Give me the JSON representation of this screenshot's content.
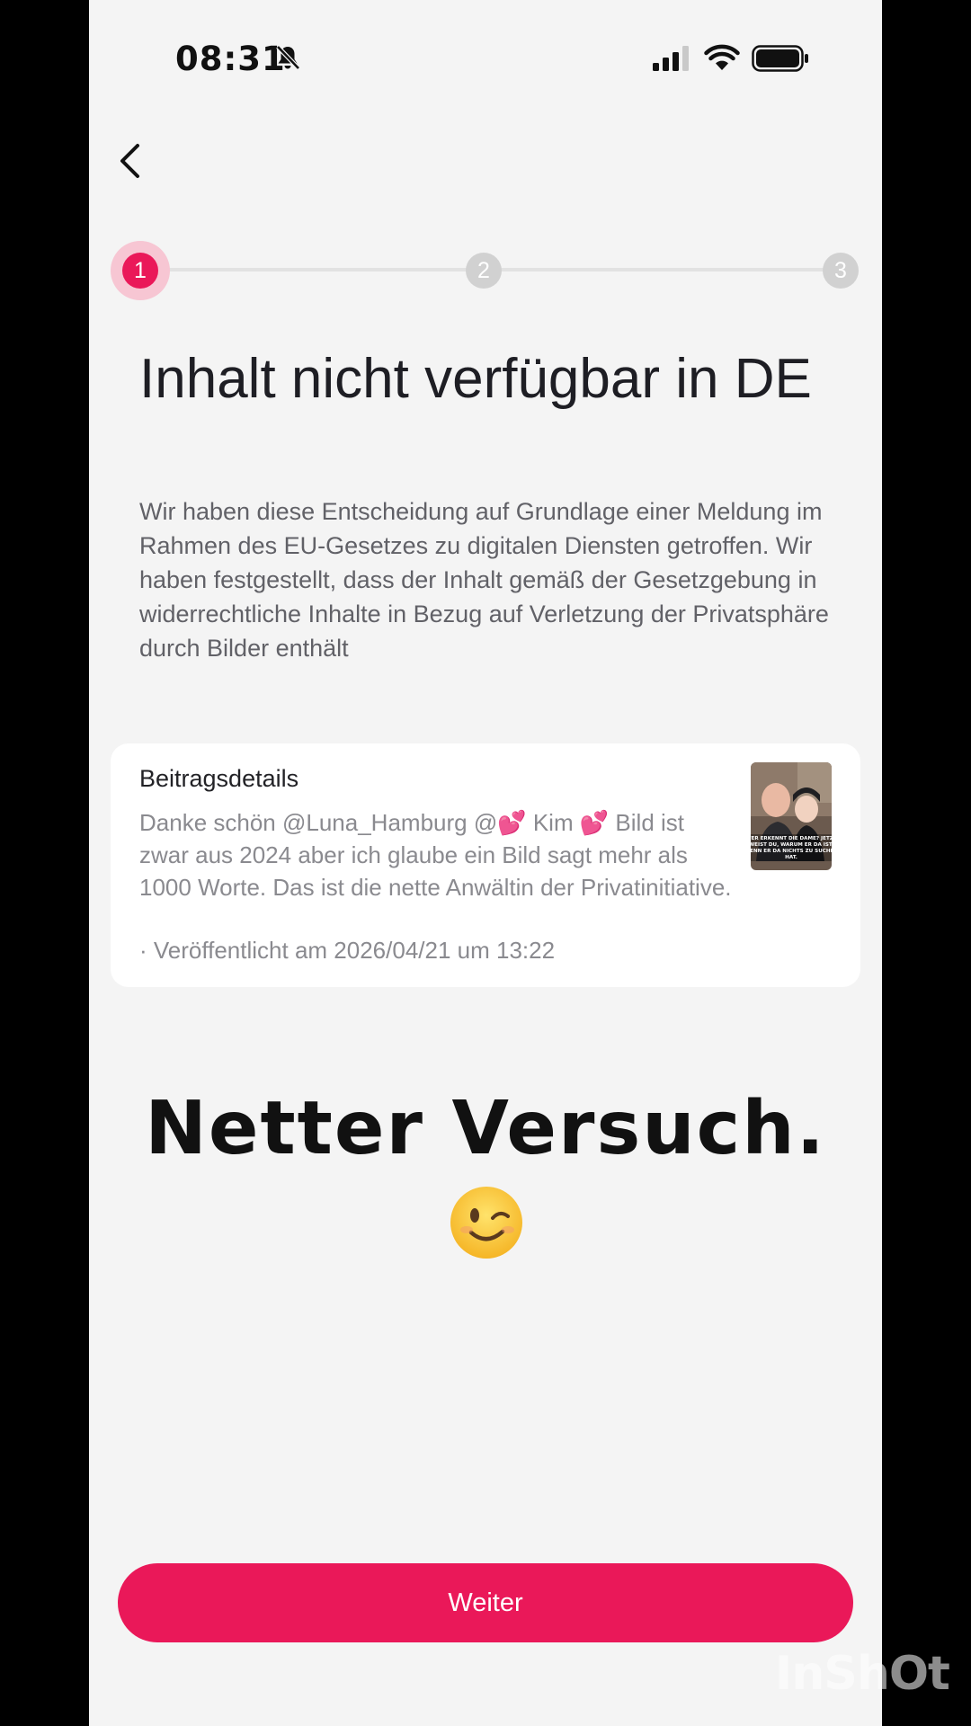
{
  "status_bar": {
    "time": "08:31",
    "icons": [
      "bell-muted-icon",
      "cellular-signal-icon",
      "wifi-icon",
      "battery-icon"
    ]
  },
  "navigation": {
    "back_icon": "chevron-left-icon"
  },
  "stepper": {
    "steps": [
      "1",
      "2",
      "3"
    ],
    "current_step": 1,
    "active_color": "#ea1859",
    "inactive_color": "#d1d1d1"
  },
  "main": {
    "title": "Inhalt nicht verfügbar in DE",
    "description": "Wir haben diese Entscheidung auf Grundlage einer Meldung im Rahmen des EU-Gesetzes zu digitalen Diensten getroffen. Wir haben festgestellt, dass der Inhalt gemäß der Gesetzgebung in widerrechtliche Inhalte in Bezug auf Verletzung der Privatsphäre durch Bilder enthält"
  },
  "post_details": {
    "heading": "Beitragsdetails",
    "text": "Danke schön @Luna_Hamburg @💕 Kim 💕 Bild ist zwar aus 2024 aber ich glaube ein Bild sagt mehr als 1000 Worte. Das ist die nette Anwältin der Privatinitiative.",
    "published": "· Veröffentlicht am 2026/04/21 um 13:22",
    "thumbnail_caption": "WER ERKENNT DIE DAME? JETZT WEIST DU, WARUM ER DA IST, WENN ER DA NICHTS ZU SUCHEN HAT."
  },
  "overlay": {
    "caption": "Netter Versuch.",
    "emoji": "😉"
  },
  "actions": {
    "continue_label": "Weiter",
    "accent_color": "#ea1859"
  },
  "watermark": {
    "text": "InShOt"
  }
}
